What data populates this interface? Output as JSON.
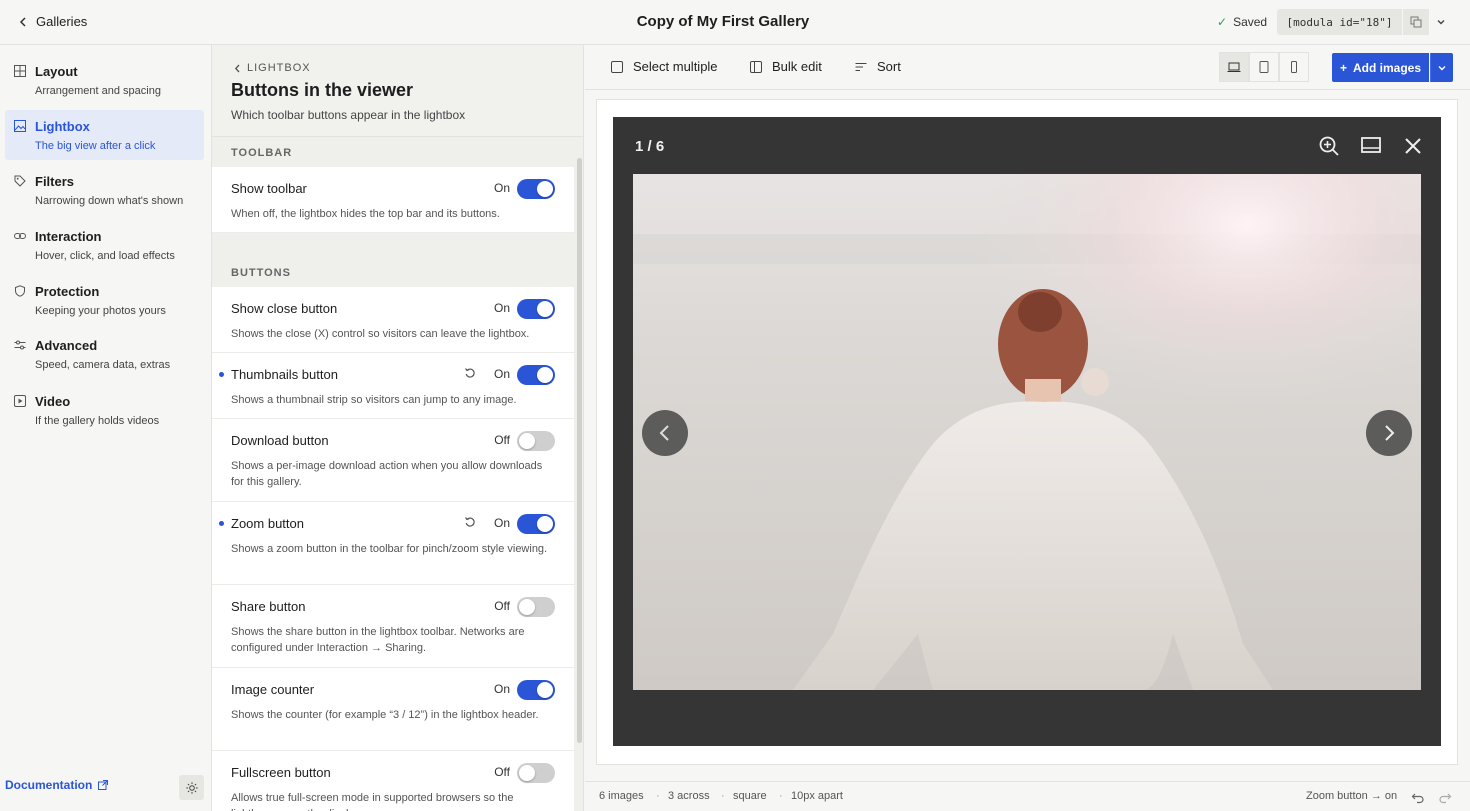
{
  "header": {
    "back_label": "Galleries",
    "title": "Copy of My First Gallery",
    "saved_label": "Saved",
    "shortcode": "[modula id=\"18\"]"
  },
  "sidebar": {
    "items": [
      {
        "title": "Layout",
        "subtitle": "Arrangement and spacing",
        "icon": "grid-icon"
      },
      {
        "title": "Lightbox",
        "subtitle": "The big view after a click",
        "icon": "image-icon",
        "active": true
      },
      {
        "title": "Filters",
        "subtitle": "Narrowing down what's shown",
        "icon": "tag-icon"
      },
      {
        "title": "Interaction",
        "subtitle": "Hover, click, and load effects",
        "icon": "link-icon"
      },
      {
        "title": "Protection",
        "subtitle": "Keeping your photos yours",
        "icon": "shield-icon"
      },
      {
        "title": "Advanced",
        "subtitle": "Speed, camera data, extras",
        "icon": "sliders-icon"
      },
      {
        "title": "Video",
        "subtitle": "If the gallery holds videos",
        "icon": "play-icon"
      }
    ],
    "documentation_label": "Documentation"
  },
  "panel": {
    "crumb": "LIGHTBOX",
    "title": "Buttons in the viewer",
    "description": "Which toolbar buttons appear in the lightbox",
    "sections": {
      "toolbar": "TOOLBAR",
      "buttons": "BUTTONS"
    },
    "settings": [
      {
        "title": "Show toolbar",
        "state": "On",
        "on": true,
        "desc": "When off, the lightbox hides the top bar and its buttons."
      },
      {
        "title": "Show close button",
        "state": "On",
        "on": true,
        "desc": "Shows the close (X) control so visitors can leave the lightbox."
      },
      {
        "title": "Thumbnails button",
        "state": "On",
        "on": true,
        "modified": true,
        "desc": "Shows a thumbnail strip so visitors can jump to any image."
      },
      {
        "title": "Download button",
        "state": "Off",
        "on": false,
        "desc": "Shows a per-image download action when you allow downloads for this gallery."
      },
      {
        "title": "Zoom button",
        "state": "On",
        "on": true,
        "modified": true,
        "desc": "Shows a zoom button in the toolbar for pinch/zoom style viewing."
      },
      {
        "title": "Share button",
        "state": "Off",
        "on": false,
        "desc": "Shows the share button in the lightbox toolbar. Networks are configured under Interaction → Sharing."
      },
      {
        "title": "Image counter",
        "state": "On",
        "on": true,
        "desc": "Shows the counter (for example “3 / 12”) in the lightbox header."
      },
      {
        "title": "Fullscreen button",
        "state": "Off",
        "on": false,
        "desc": "Allows true full-screen mode in supported browsers so the lightbox covers the display."
      }
    ]
  },
  "preview_toolbar": {
    "select_multiple": "Select multiple",
    "bulk_edit": "Bulk edit",
    "sort": "Sort",
    "add_images": "Add images"
  },
  "lightbox": {
    "counter": "1 / 6"
  },
  "status": {
    "images": "6 images",
    "across": "3 across",
    "shape": "square",
    "spacing": "10px apart",
    "last_change": "Zoom button → on"
  },
  "colors": {
    "accent": "#2a55d6",
    "lightbox_bg": "#353535"
  }
}
